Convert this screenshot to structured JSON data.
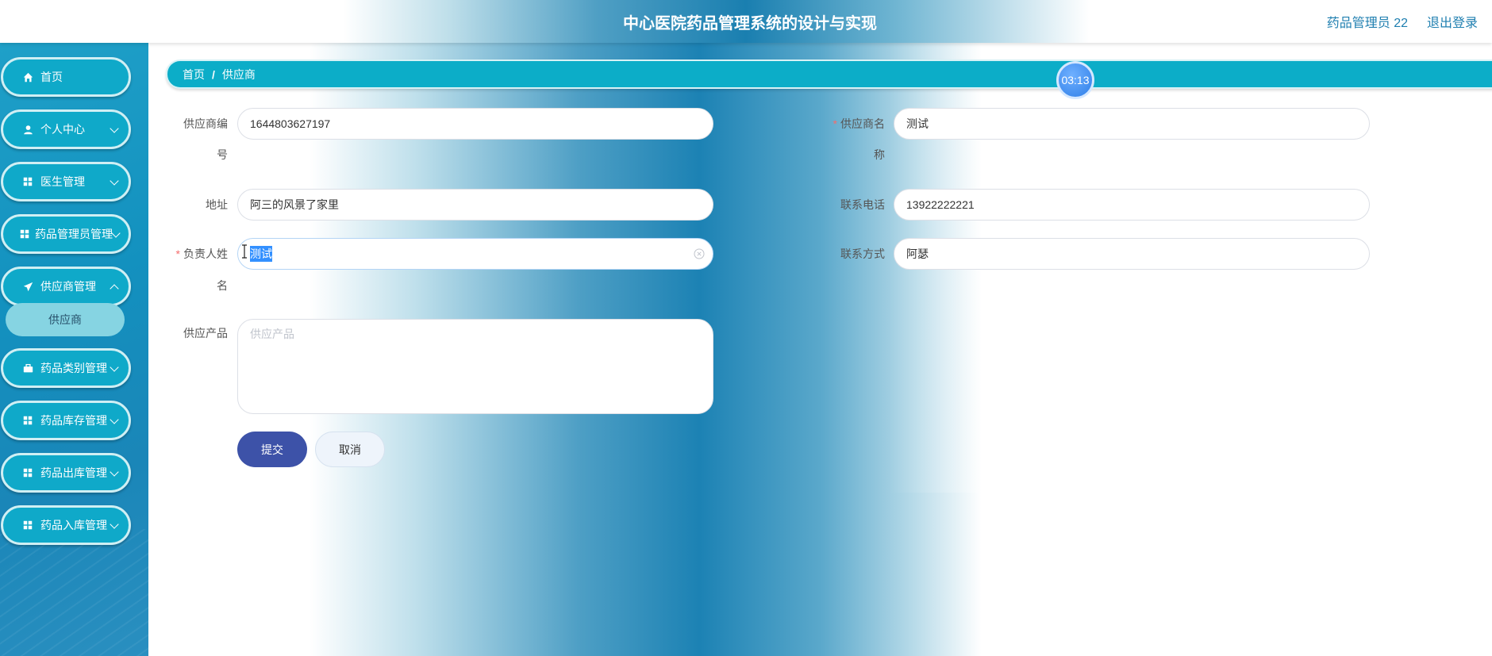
{
  "header": {
    "title": "中心医院药品管理系统的设计与实现",
    "user": "药品管理员 22",
    "logout": "退出登录"
  },
  "sidebar": {
    "items": [
      {
        "label": "首页",
        "icon": "home-icon"
      },
      {
        "label": "个人中心",
        "icon": "user-icon"
      },
      {
        "label": "医生管理",
        "icon": "grid-icon"
      },
      {
        "label": "药品管理员管理",
        "icon": "grid-icon"
      },
      {
        "label": "供应商管理",
        "icon": "send-icon"
      },
      {
        "label": "药品类别管理",
        "icon": "briefcase-icon"
      },
      {
        "label": "药品库存管理",
        "icon": "grid-icon"
      },
      {
        "label": "药品出库管理",
        "icon": "grid-icon"
      },
      {
        "label": "药品入库管理",
        "icon": "grid-icon"
      }
    ],
    "submenu": {
      "label": "供应商"
    }
  },
  "breadcrumb": {
    "home": "首页",
    "separator": "/",
    "current": "供应商"
  },
  "timer": "03:13",
  "form": {
    "supplier_no": {
      "label_line1": "供应商编",
      "label_line2": "号",
      "value": "1644803627197"
    },
    "supplier_name": {
      "required": "*",
      "label_line1": "供应商名",
      "label_line2": "称",
      "value": "测试"
    },
    "address": {
      "label": "地址",
      "value": "阿三的风景了家里"
    },
    "phone": {
      "label": "联系电话",
      "value": "13922222221"
    },
    "manager": {
      "required": "*",
      "label_line1": "负责人姓",
      "label_line2": "名",
      "value": "测试"
    },
    "contact": {
      "label": "联系方式",
      "value": "阿瑟"
    },
    "products": {
      "label": "供应产品",
      "placeholder": "供应产品"
    }
  },
  "buttons": {
    "submit": "提交",
    "cancel": "取消"
  }
}
